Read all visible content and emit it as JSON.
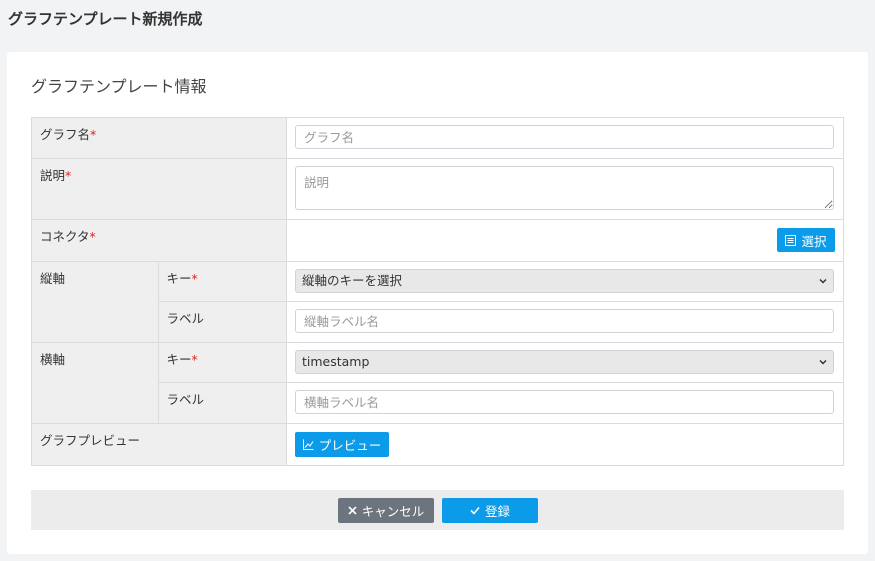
{
  "page": {
    "title": "グラフテンプレート新規作成"
  },
  "form": {
    "section_title": "グラフテンプレート情報",
    "required_mark": "*",
    "graph_name": {
      "label": "グラフ名",
      "placeholder": "グラフ名",
      "value": ""
    },
    "description": {
      "label": "説明",
      "placeholder": "説明",
      "value": ""
    },
    "connector": {
      "label": "コネクタ",
      "select_button": "選択"
    },
    "vertical_axis": {
      "label": "縦軸",
      "key_label": "キー",
      "key_selected": "縦軸のキーを選択",
      "label_label": "ラベル",
      "label_placeholder": "縦軸ラベル名"
    },
    "horizontal_axis": {
      "label": "横軸",
      "key_label": "キー",
      "key_selected": "timestamp",
      "label_label": "ラベル",
      "label_placeholder": "横軸ラベル名"
    },
    "preview": {
      "label": "グラフプレビュー",
      "button": "プレビュー"
    }
  },
  "footer": {
    "cancel_label": "キャンセル",
    "submit_label": "登録"
  },
  "colors": {
    "primary": "#0b9be8",
    "secondary": "#6c757d",
    "required": "#e02020"
  }
}
